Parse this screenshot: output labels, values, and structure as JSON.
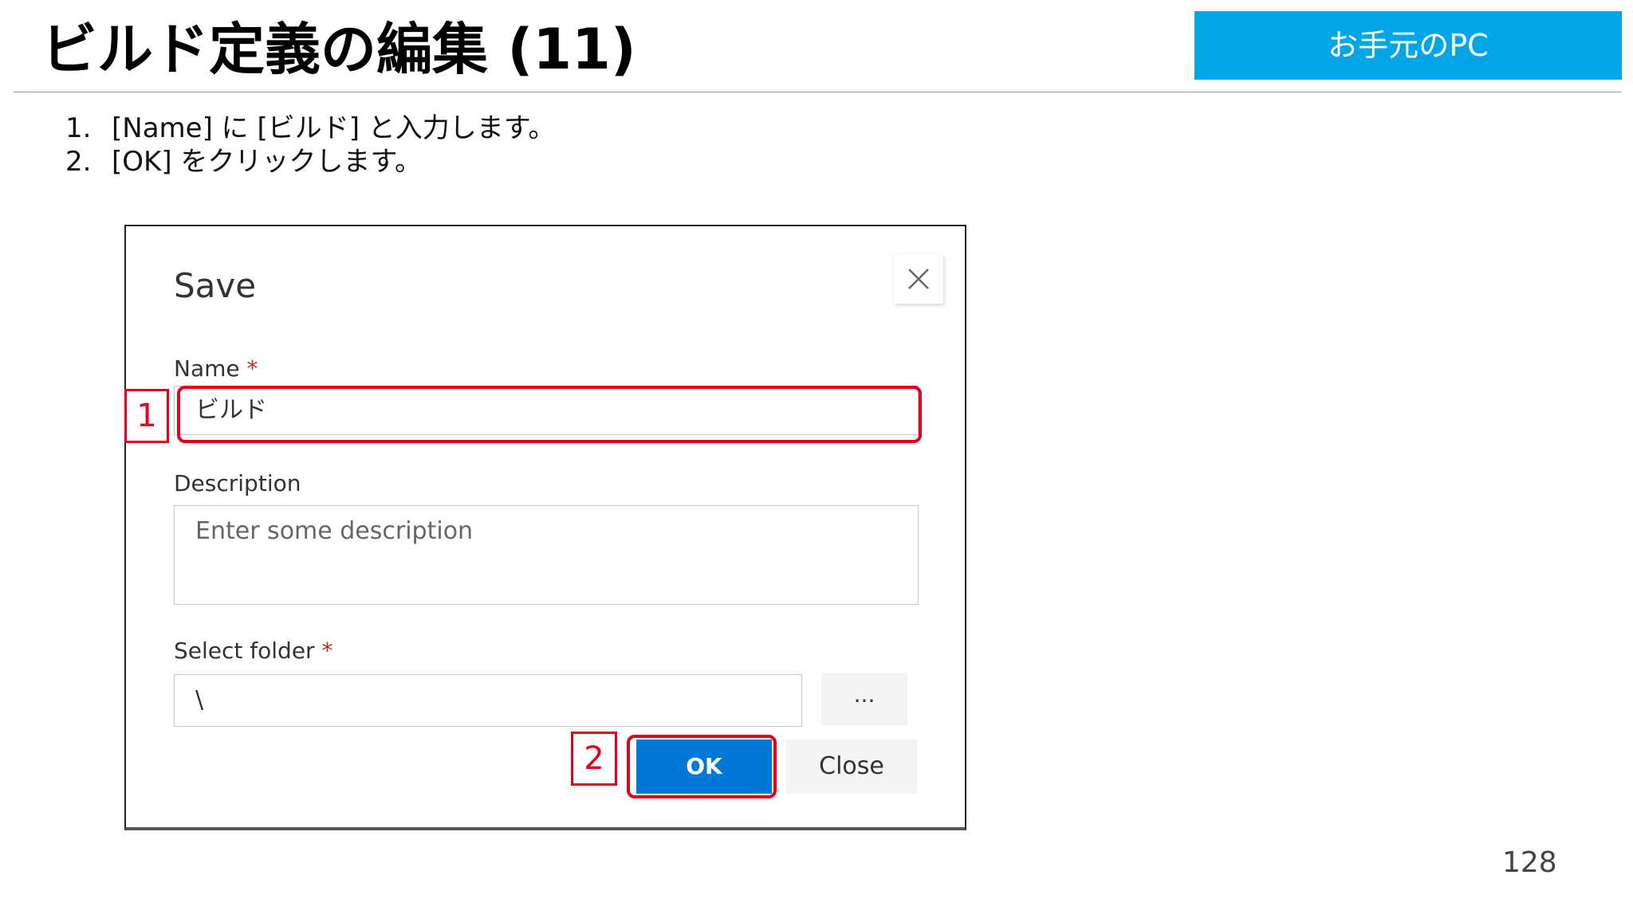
{
  "slide": {
    "title": "ビルド定義の編集 (11)",
    "badge": "お手元のPC",
    "page_number": "128"
  },
  "steps": [
    {
      "number": "1.",
      "text": "[Name] に [ビルド] と入力します。"
    },
    {
      "number": "2.",
      "text": "[OK] をクリックします。"
    }
  ],
  "dialog": {
    "title": "Save",
    "close_icon": "close-icon",
    "name_label": "Name",
    "name_value": "ビルド",
    "description_label": "Description",
    "description_placeholder": "Enter some description",
    "folder_label": "Select folder",
    "folder_value": "\\",
    "required_mark": "*",
    "browse_label": "...",
    "ok_label": "OK",
    "close_label": "Close"
  },
  "callouts": {
    "one": "1",
    "two": "2"
  },
  "colors": {
    "badge": "#00a6e6",
    "primary_button": "#0078d7",
    "highlight": "#e0001b"
  }
}
